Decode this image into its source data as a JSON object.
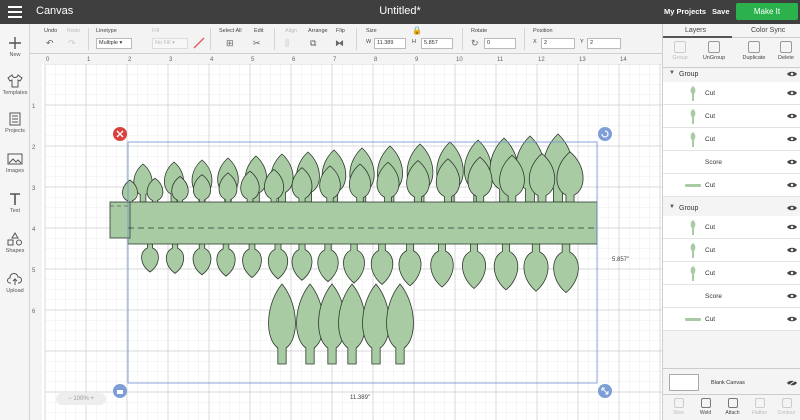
{
  "header": {
    "app_title": "Canvas",
    "doc_title": "Untitled*",
    "my_projects": "My Projects",
    "save": "Save",
    "make_it": "Make It"
  },
  "sidebar": {
    "items": [
      {
        "label": "New",
        "icon": "plus-icon"
      },
      {
        "label": "Templates",
        "icon": "shirt-icon"
      },
      {
        "label": "Projects",
        "icon": "projects-icon"
      },
      {
        "label": "Images",
        "icon": "image-icon"
      },
      {
        "label": "Text",
        "icon": "text-icon"
      },
      {
        "label": "Shapes",
        "icon": "shapes-icon"
      },
      {
        "label": "Upload",
        "icon": "upload-icon"
      }
    ]
  },
  "toolbar": {
    "undo": "Undo",
    "redo": "Redo",
    "linetype_label": "Linetype",
    "linetype_value": "Multiple",
    "fill_label": "Fill",
    "fill_value": "No Fill",
    "select_all": "Select All",
    "edit": "Edit",
    "align": "Align",
    "arrange": "Arrange",
    "flip": "Flip",
    "size_label": "Size",
    "w_label": "W",
    "w_value": "11.389",
    "h_label": "H",
    "h_value": "5.857",
    "rotate_label": "Rotate",
    "rotate_value": "0",
    "position_label": "Position",
    "x_label": "X",
    "x_value": "2",
    "y_label": "Y",
    "y_value": "2"
  },
  "canvas": {
    "ruler_x": [
      "0",
      "1",
      "2",
      "3",
      "4",
      "5",
      "6",
      "7",
      "8",
      "9",
      "10",
      "11",
      "12",
      "13",
      "14"
    ],
    "ruler_y": [
      "1",
      "2",
      "3",
      "4",
      "5",
      "6"
    ],
    "width_label": "11.389\"",
    "height_label": "5.857\"",
    "zoom": "100%",
    "shape_color": "#a8cba4",
    "selection_color": "#6b8fd6"
  },
  "panel": {
    "tab_layers": "Layers",
    "tab_color_sync": "Color Sync",
    "tools": [
      "Group",
      "UnGroup",
      "Duplicate",
      "Delete"
    ],
    "groups": [
      {
        "name": "Group",
        "layers": [
          "Cut",
          "Cut",
          "Cut",
          "Score",
          "Cut"
        ]
      },
      {
        "name": "Group",
        "layers": [
          "Cut",
          "Cut",
          "Cut",
          "Score",
          "Cut"
        ]
      }
    ],
    "blank_canvas": "Blank Canvas",
    "bottom_tools": [
      "Slice",
      "Weld",
      "Attach",
      "Flatten",
      "Contour"
    ]
  }
}
